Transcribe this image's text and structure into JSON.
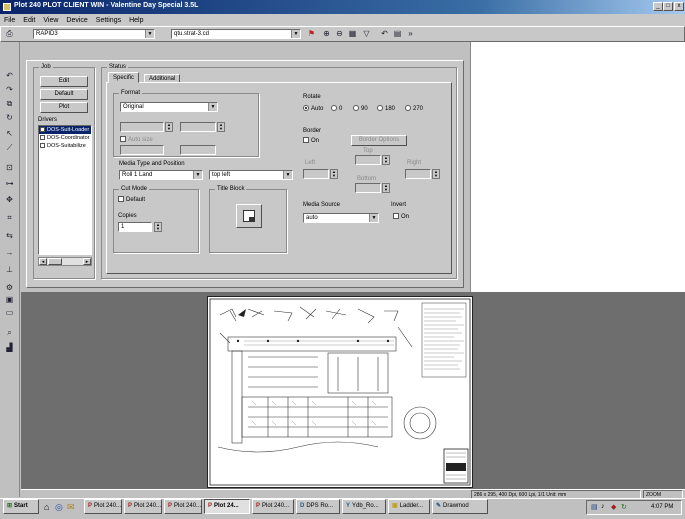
{
  "window": {
    "title": "Plot 240 PLOT CLIENT WIN - Valentine Day Special 3.5L",
    "controls": [
      "_",
      "□",
      "x"
    ]
  },
  "menu": [
    "File",
    "Edit",
    "View",
    "Device",
    "Settings",
    "Help"
  ],
  "toolbar": {
    "printer_value": "RAPID3",
    "file_value": "qtu.strat-3.cd"
  },
  "panel": {
    "job_label": "Job",
    "job_buttons": [
      "Edit",
      "Default",
      "Plot"
    ],
    "drivers_label": "Drivers",
    "drivers": [
      "DOS-Suit-Loader",
      "DOS-Coordinator",
      "DOS-Suitabilize"
    ],
    "tabs": [
      "Specific",
      "Additional"
    ],
    "status_label": "Status",
    "format_label": "Format",
    "format_value": "Original",
    "auto_size_label": "Auto size",
    "media_type_label": "Media Type and Position",
    "media_type_value": "Roll 1 Land",
    "media_position_value": "top left",
    "cut_mode_label": "Cut Mode",
    "cut_mode_option": "Default",
    "copies_label": "Copies",
    "copies_value": "1",
    "title_block_label": "Title Block",
    "rotate_label": "Rotate",
    "rotate_options": [
      "Auto",
      "0",
      "90",
      "180",
      "270"
    ],
    "border_label": "Border",
    "border_option": "On",
    "border_button": "Border Options",
    "border_disabled_labels": [
      "Top",
      "Left",
      "Bottom",
      "Right"
    ],
    "media_source_label": "Media Source",
    "media_source_value": "auto",
    "invert_label": "Invert",
    "invert_option": "On"
  },
  "status_bar": {
    "text": "286 x 295, 400 Dpi, 600 Lpi, 1/1  Unit: mm",
    "zoom": "ZOOM"
  },
  "taskbar": {
    "start_label": "Start",
    "items": [
      "Plot 240...",
      "Plot 240...",
      "Plot 240...",
      "Plot 24...",
      "Plot 240...",
      "DPS Ro...",
      "Ydb_Ro...",
      "Ladder...",
      "Drawmod"
    ],
    "clock": "4:07 PM"
  },
  "colors": {
    "title_bar_start": "#0a246a",
    "title_bar_end": "#a6caf0",
    "workspace": "#6e6e6e",
    "panel": "#c8c8c8",
    "selection": "#0a246a"
  }
}
